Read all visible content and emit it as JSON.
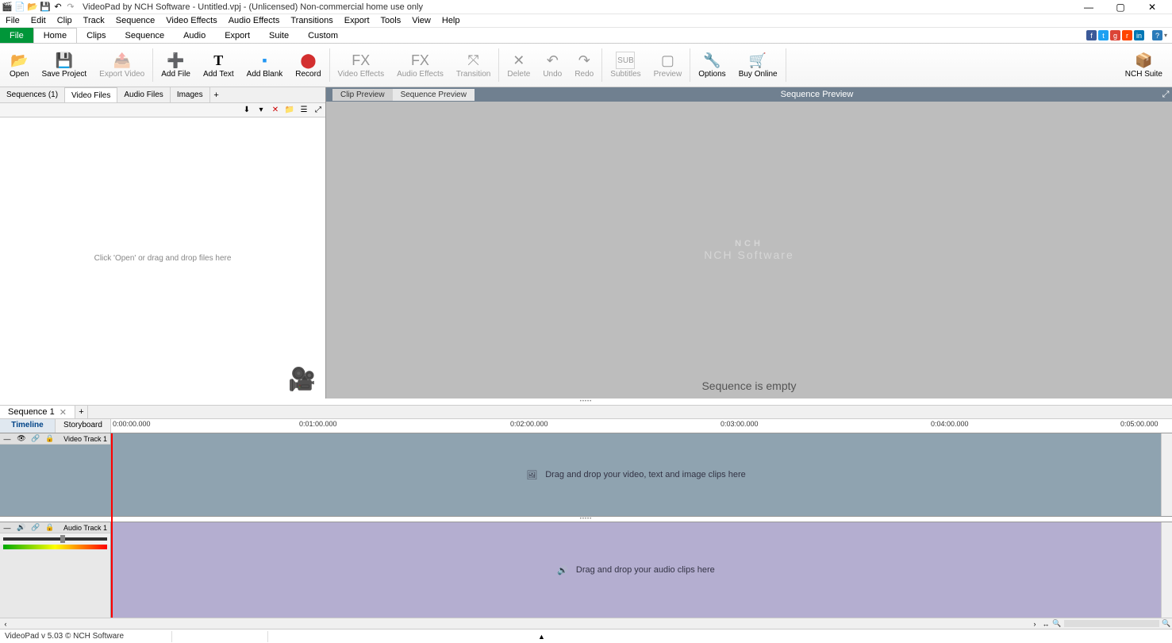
{
  "titlebar": {
    "title": "VideoPad by NCH Software - Untitled.vpj - (Unlicensed) Non-commercial home use only"
  },
  "menubar": [
    "File",
    "Edit",
    "Clip",
    "Track",
    "Sequence",
    "Video Effects",
    "Audio Effects",
    "Transitions",
    "Export",
    "Tools",
    "View",
    "Help"
  ],
  "ribbon_tabs": {
    "file": "File",
    "items": [
      "Home",
      "Clips",
      "Sequence",
      "Audio",
      "Export",
      "Suite",
      "Custom"
    ],
    "active": "Home"
  },
  "ribbon_buttons": {
    "open": "Open",
    "save": "Save Project",
    "export": "Export Video",
    "addfile": "Add File",
    "addtext": "Add Text",
    "addblank": "Add Blank",
    "record": "Record",
    "videoeffects": "Video Effects",
    "audioeffects": "Audio Effects",
    "transition": "Transition",
    "delete": "Delete",
    "undo": "Undo",
    "redo": "Redo",
    "subtitles": "Subtitles",
    "preview": "Preview",
    "options": "Options",
    "buyonline": "Buy Online",
    "nchsuite": "NCH Suite"
  },
  "media_tabs": {
    "sequences": "Sequences (1)",
    "video": "Video Files",
    "audio": "Audio Files",
    "images": "Images",
    "add": "+"
  },
  "media_hint": "Click 'Open' or drag and drop files here",
  "preview": {
    "clip_tab": "Clip Preview",
    "seq_tab": "Sequence Preview",
    "title": "Sequence Preview",
    "logo_main": "NCH",
    "logo_sub": "NCH Software",
    "empty": "Sequence is empty"
  },
  "sequence_tab": {
    "name": "Sequence 1",
    "add": "+"
  },
  "view_tabs": {
    "timeline": "Timeline",
    "storyboard": "Storyboard"
  },
  "ruler_times": [
    "0:00:00.000",
    "0:01:00.000",
    "0:02:00.000",
    "0:03:00.000",
    "0:04:00.000",
    "0:05:00.000"
  ],
  "tracks": {
    "video_name": "Video Track 1",
    "video_hint": "Drag and drop your video, text and image clips here",
    "audio_name": "Audio Track 1",
    "audio_hint": "Drag and drop your audio clips here"
  },
  "status": {
    "version": "VideoPad v 5.03 © NCH Software"
  }
}
